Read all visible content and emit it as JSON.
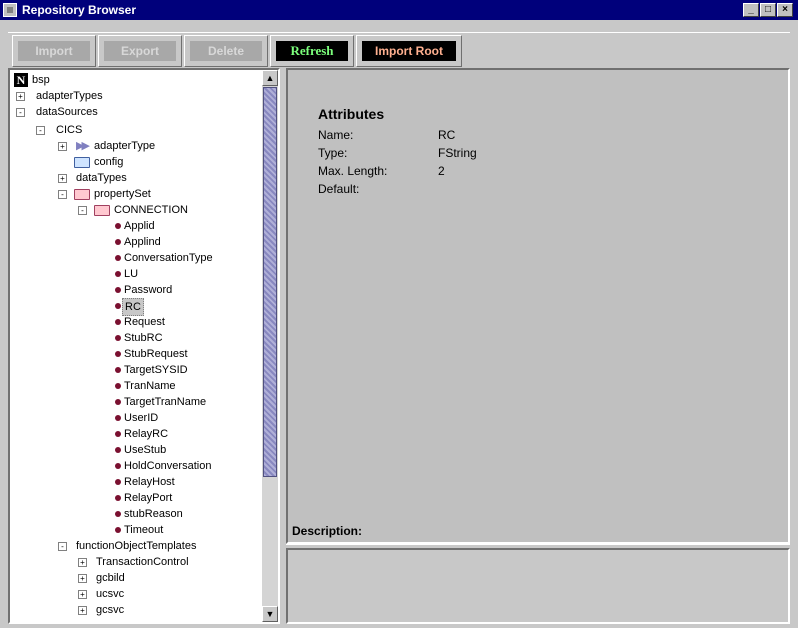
{
  "window": {
    "title": "Repository Browser"
  },
  "toolbar": {
    "import_label": "Import",
    "export_label": "Export",
    "delete_label": "Delete",
    "refresh_label": "Refresh",
    "import_root_label": "Import Root"
  },
  "tree": {
    "root": "bsp",
    "adapterTypes": "adapterTypes",
    "dataSources": "dataSources",
    "cics": "CICS",
    "adapterType": "adapterType",
    "config": "config",
    "dataTypes": "dataTypes",
    "propertySet": "propertySet",
    "connection": "CONNECTION",
    "properties": [
      "Applid",
      "Applind",
      "ConversationType",
      "LU",
      "Password",
      "RC",
      "Request",
      "StubRC",
      "StubRequest",
      "TargetSYSID",
      "TranName",
      "TargetTranName",
      "UserID",
      "RelayRC",
      "UseStub",
      "HoldConversation",
      "RelayHost",
      "RelayPort",
      "stubReason",
      "Timeout"
    ],
    "selected": "RC",
    "functionObjectTemplates": "functionObjectTemplates",
    "templates": [
      "TransactionControl",
      "gcbild",
      "ucsvc",
      "gcsvc"
    ]
  },
  "attributes": {
    "heading": "Attributes",
    "name_key": "Name:",
    "name_value": "RC",
    "type_key": "Type:",
    "type_value": "FString",
    "maxlen_key": "Max. Length:",
    "maxlen_value": "2",
    "default_key": "Default:",
    "default_value": ""
  },
  "description": {
    "label": "Description:"
  }
}
